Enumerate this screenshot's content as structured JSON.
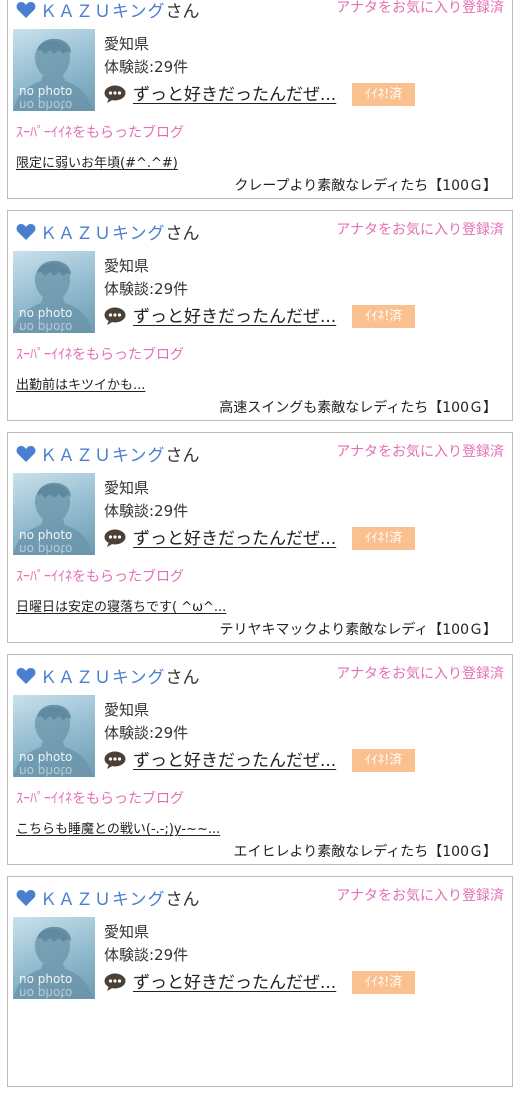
{
  "cards": [
    {
      "username": "ＫＡＺＵキング",
      "suffix": "さん",
      "favorite_status": "アナタをお気に入り登録済",
      "avatar_text": "no photo",
      "prefecture": "愛知県",
      "review_count": "体験談:29件",
      "review_title": "ずっと好きだったんだぜ...",
      "like_status": "ｲｲﾈ!済",
      "section_title": "ｽｰﾊﾟｰｲｲﾈをもらったブログ",
      "blog_title": "限定に弱いお年頃(#^.^#)",
      "product": "クレープより素敵なレディたち【100Ｇ】"
    },
    {
      "username": "ＫＡＺＵキング",
      "suffix": "さん",
      "favorite_status": "アナタをお気に入り登録済",
      "avatar_text": "no photo",
      "prefecture": "愛知県",
      "review_count": "体験談:29件",
      "review_title": "ずっと好きだったんだぜ...",
      "like_status": "ｲｲﾈ!済",
      "section_title": "ｽｰﾊﾟｰｲｲﾈをもらったブログ",
      "blog_title": "出勤前はキツイかも...",
      "product": "高速スイングも素敵なレディたち【100Ｇ】"
    },
    {
      "username": "ＫＡＺＵキング",
      "suffix": "さん",
      "favorite_status": "アナタをお気に入り登録済",
      "avatar_text": "no photo",
      "prefecture": "愛知県",
      "review_count": "体験談:29件",
      "review_title": "ずっと好きだったんだぜ...",
      "like_status": "ｲｲﾈ!済",
      "section_title": "ｽｰﾊﾟｰｲｲﾈをもらったブログ",
      "blog_title": "日曜日は安定の寝落ちです( ^ω^...",
      "product": "テリヤキマックより素敵なレディ【100Ｇ】"
    },
    {
      "username": "ＫＡＺＵキング",
      "suffix": "さん",
      "favorite_status": "アナタをお気に入り登録済",
      "avatar_text": "no photo",
      "prefecture": "愛知県",
      "review_count": "体験談:29件",
      "review_title": "ずっと好きだったんだぜ...",
      "like_status": "ｲｲﾈ!済",
      "section_title": "ｽｰﾊﾟｰｲｲﾈをもらったブログ",
      "blog_title": "こちらも睡魔との戦い(-.-;)y-~~...",
      "product": "エイヒレより素敵なレディたち【100Ｇ】"
    },
    {
      "username": "ＫＡＺＵキング",
      "suffix": "さん",
      "favorite_status": "アナタをお気に入り登録済",
      "avatar_text": "no photo",
      "prefecture": "愛知県",
      "review_count": "体験談:29件",
      "review_title": "ずっと好きだったんだぜ...",
      "like_status": "ｲｲﾈ!済",
      "section_title": "",
      "blog_title": "",
      "product": ""
    }
  ],
  "icons": {
    "heart": "heart-icon",
    "comment": "speech-bubble-icon"
  },
  "colors": {
    "username": "#4a7fd0",
    "pink": "#e56fb3",
    "like_badge": "#fbc08f",
    "border": "#bcbcbc"
  }
}
